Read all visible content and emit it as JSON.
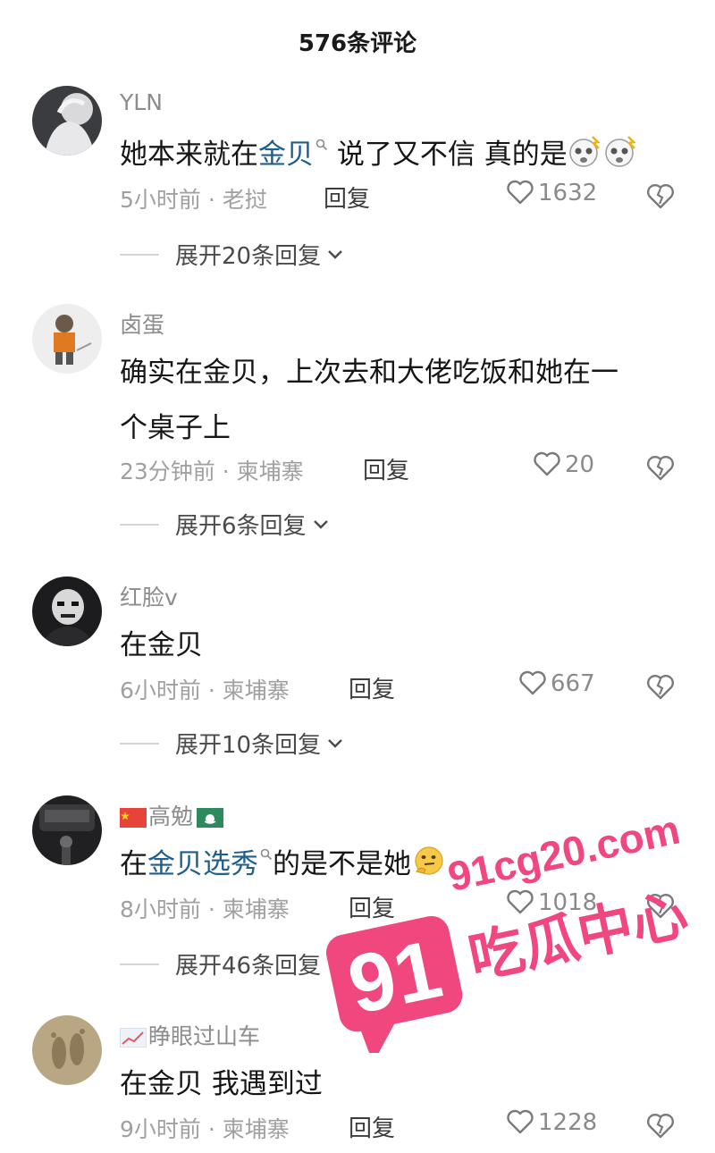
{
  "header": {
    "title": "576条评论"
  },
  "comments": [
    {
      "username": "YLN",
      "text_parts": [
        "她本来就在",
        "金贝",
        " 说了又不信 真的是"
      ],
      "time": "5小时前",
      "location": "老挝",
      "reply_label": "回复",
      "likes": "1632",
      "expand_label": "展开20条回复"
    },
    {
      "username": "卤蛋",
      "text_line1": "确实在金贝，上次去和大佬吃饭和她在一",
      "text_line2": "个桌子上",
      "time": "23分钟前",
      "location": "柬埔寨",
      "reply_label": "回复",
      "likes": "20",
      "expand_label": "展开6条回复"
    },
    {
      "username": "红脸v",
      "text": "在金贝",
      "time": "6小时前",
      "location": "柬埔寨",
      "reply_label": "回复",
      "likes": "667",
      "expand_label": "展开10条回复"
    },
    {
      "username": "高勉",
      "text_parts": [
        "在",
        "金贝选秀",
        "的是不是她"
      ],
      "time": "8小时前",
      "location": "柬埔寨",
      "reply_label": "回复",
      "likes": "1018",
      "expand_label": "展开46条回复"
    },
    {
      "username": "睁眼过山车",
      "text": "在金贝 我遇到过",
      "time": "9小时前",
      "location": "柬埔寨",
      "reply_label": "回复",
      "likes": "1228"
    }
  ],
  "watermark": {
    "domain": "91cg20.com",
    "number": "91",
    "slogan": "吃瓜中心",
    "color": "#f0477f"
  },
  "colors": {
    "link": "#1f5f8c",
    "meta": "#a0a0a0",
    "watermark": "#f0477f"
  }
}
